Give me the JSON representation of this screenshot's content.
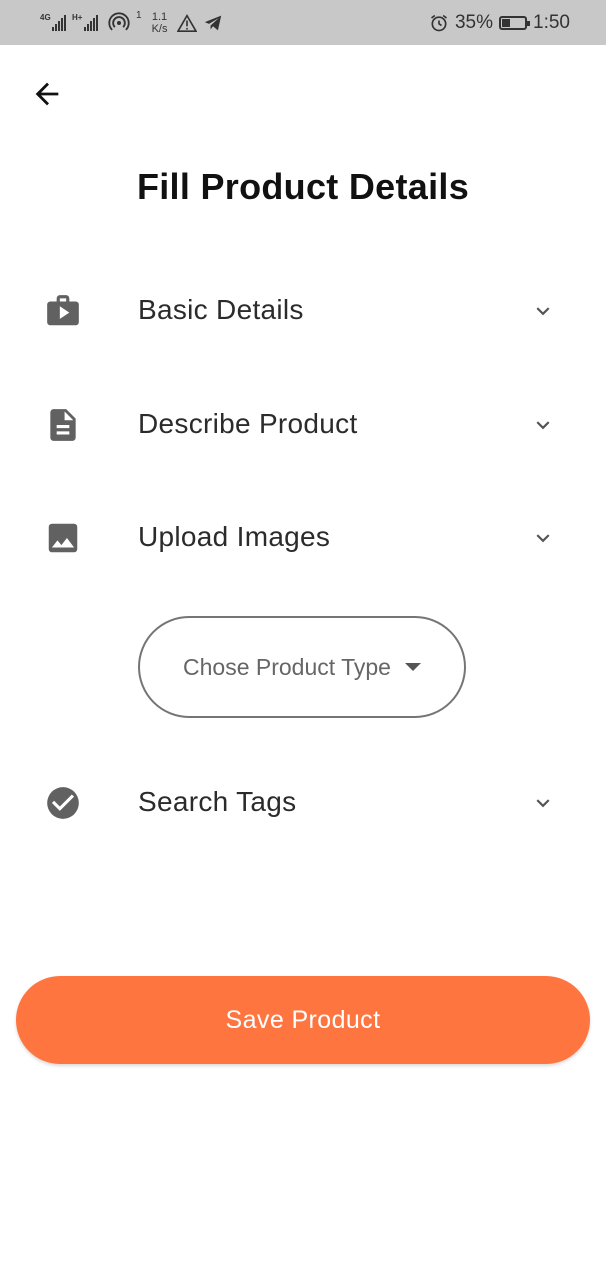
{
  "status_bar": {
    "network_1": "4G",
    "network_2": "H+",
    "hotspot_sup": "1",
    "speed_value": "1.1",
    "speed_unit": "K/s",
    "battery_percent": "35%",
    "battery_level": 0.35,
    "time": "1:50"
  },
  "header": {
    "title": "Fill Product Details"
  },
  "sections": [
    {
      "label": "Basic Details",
      "icon": "briefcase-play-icon"
    },
    {
      "label": "Describe Product",
      "icon": "document-icon"
    },
    {
      "label": "Upload Images",
      "icon": "image-icon"
    },
    {
      "label": "Search Tags",
      "icon": "check-circle-icon"
    }
  ],
  "product_type": {
    "placeholder": "Chose Product Type"
  },
  "save_button": {
    "label": "Save Product",
    "color": "#ff7540"
  }
}
